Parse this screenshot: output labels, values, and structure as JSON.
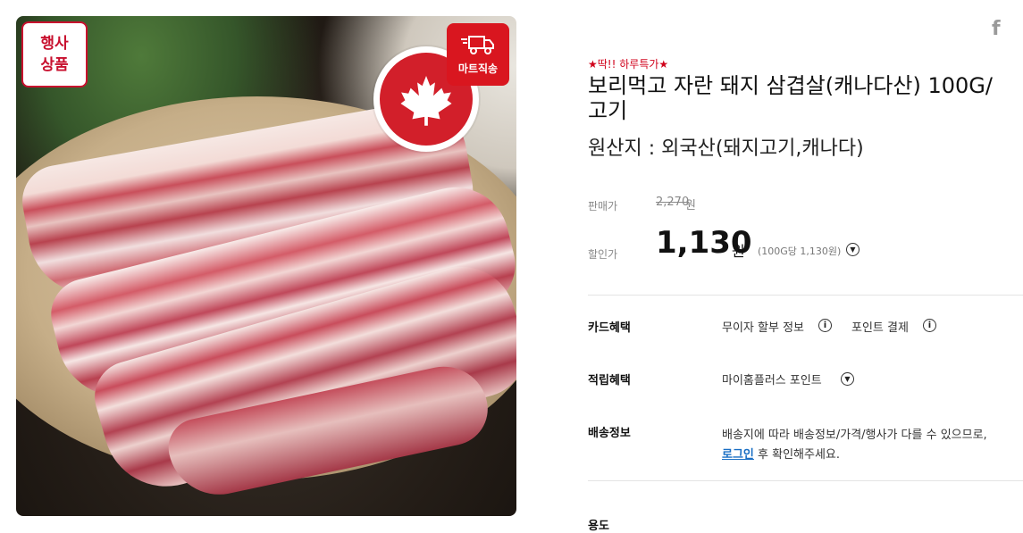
{
  "badges": {
    "event_line1": "행사",
    "event_line2": "상품",
    "mart_delivery": "마트직송"
  },
  "share": {
    "facebook_glyph": "f"
  },
  "product": {
    "promo_tag": "★딱!! 하루특가★",
    "title_line1": "보리먹고 자란 돼지 삼겹살(캐나다산) 100G/",
    "title_line2": "고기",
    "origin": "원산지 : 외국산(돼지고기,캐나다)"
  },
  "price": {
    "list_label": "판매가",
    "list_price": "2,270",
    "list_unit": "원",
    "sale_label": "할인가",
    "sale_price": "1,130",
    "sale_unit": "원",
    "unit_price": "(100G당 1,130원)"
  },
  "benefits": {
    "card_label": "카드혜택",
    "card_installment": "무이자 할부 정보",
    "card_point": "포인트 결제",
    "reward_label": "적립혜택",
    "reward_text": "마이홈플러스 포인트",
    "shipping_label": "배송정보",
    "shipping_text1": "배송지에 따라 배송정보/가격/행사가 다를 수 있으므로,",
    "shipping_login": "로그인",
    "shipping_text2": " 후 확인해주세요.",
    "usage_label": "용도"
  },
  "colors": {
    "accent_red": "#d9161f",
    "link_blue": "#1a6fc4"
  }
}
